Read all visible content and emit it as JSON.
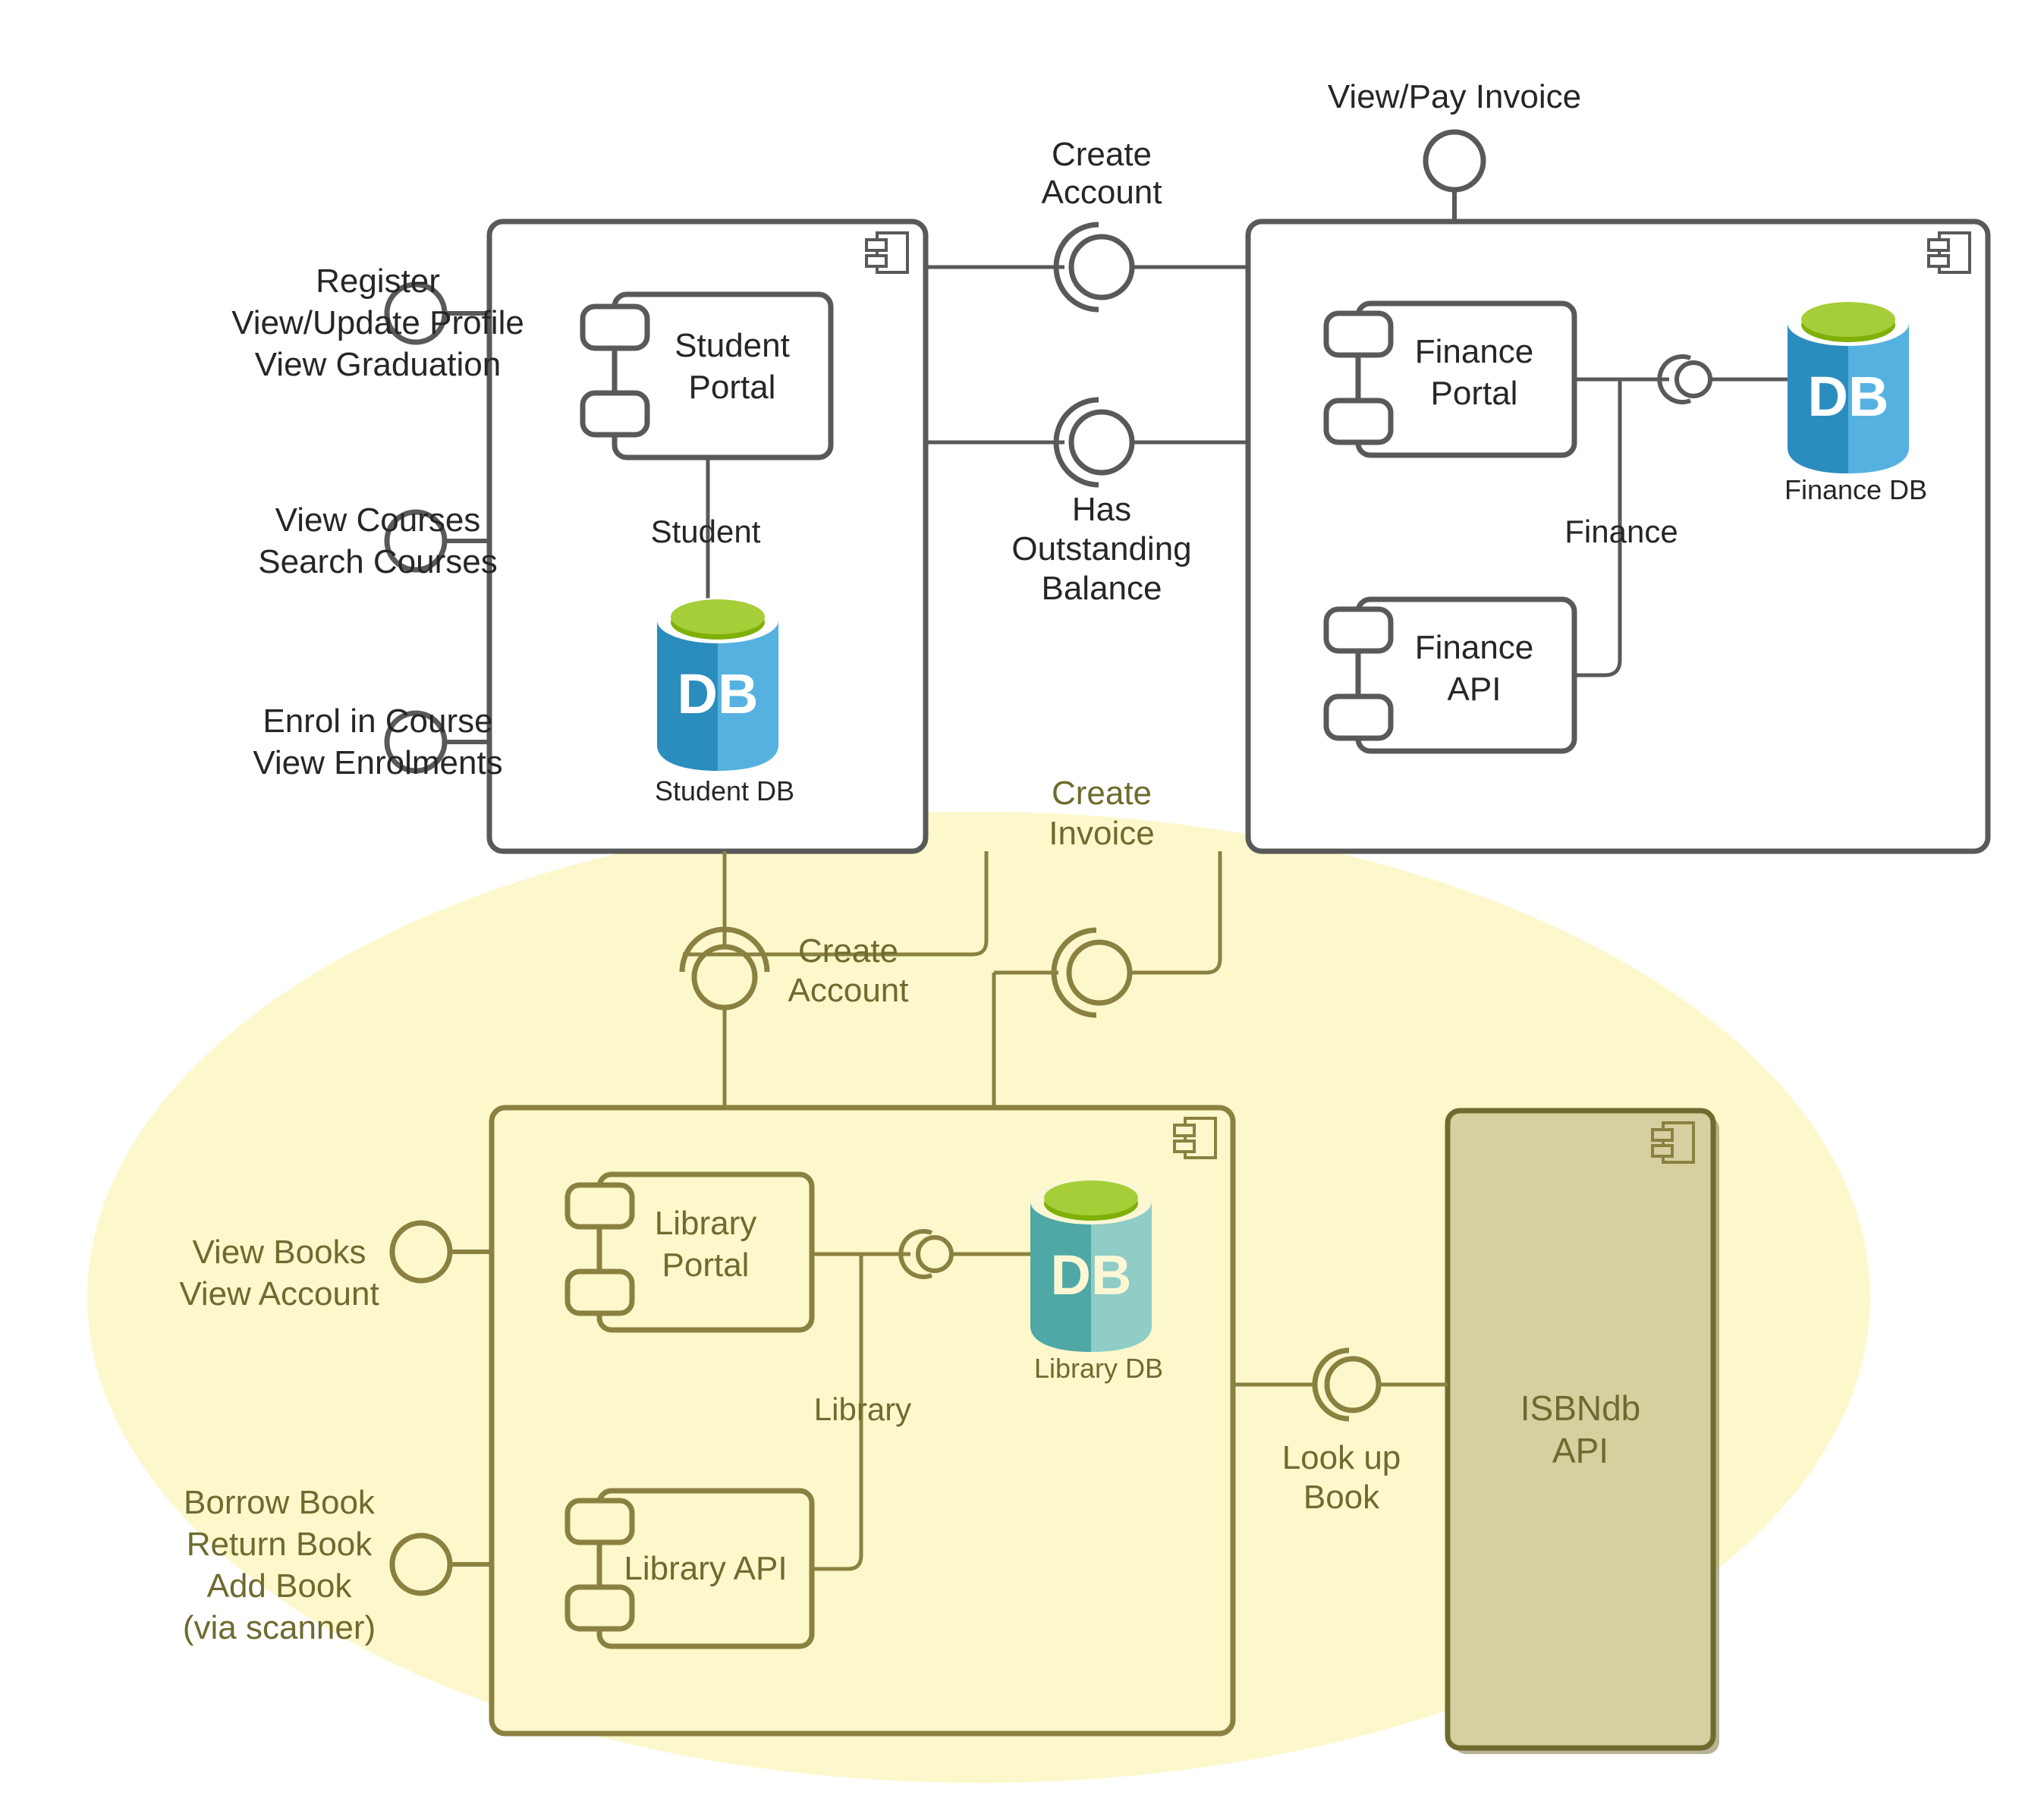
{
  "diagram": {
    "title": "University System Component Diagram",
    "type": "uml-component-diagram",
    "colors": {
      "dark_stroke": "#595959",
      "olive_stroke": "#8a8141",
      "olive_text": "#6f6a2e",
      "pale_yellow_fill": "#fcf8cc",
      "khaki_fill": "#d6d0a0",
      "db_blue_dark": "#2b8cbe",
      "db_blue_light": "#55b2e0",
      "db_green_top": "#a6ce39",
      "db_green_shadow": "#7fb008",
      "db_teal_dark": "#4fa8a5",
      "db_teal_light": "#8fcdc6",
      "white": "#ffffff"
    }
  },
  "packages": {
    "student": {
      "name": "Student",
      "icon": "component-icon"
    },
    "finance": {
      "name": "Finance",
      "icon": "component-icon"
    },
    "library": {
      "name": "Library",
      "icon": "component-icon"
    }
  },
  "components": {
    "student_portal": {
      "label_line1": "Student",
      "label_line2": "Portal"
    },
    "finance_portal": {
      "label_line1": "Finance",
      "label_line2": "Portal"
    },
    "finance_api": {
      "label_line1": "Finance",
      "label_line2": "API"
    },
    "library_portal": {
      "label_line1": "Library",
      "label_line2": "Portal"
    },
    "library_api": {
      "label_line1": "Library API",
      "label_line2": ""
    },
    "isbndb_api": {
      "label_line1": "ISBNdb",
      "label_line2": "API",
      "icon": "component-icon"
    }
  },
  "databases": {
    "student_db": {
      "caption": "Student DB",
      "glyph": "DB",
      "tone": "blue"
    },
    "finance_db": {
      "caption": "Finance DB",
      "glyph": "DB",
      "tone": "blue"
    },
    "library_db": {
      "caption": "Library DB",
      "glyph": "DB",
      "tone": "teal"
    }
  },
  "port_labels": {
    "student_profile": {
      "line1": "Register",
      "line2": "View/Update Profile",
      "line3": "View Graduation"
    },
    "courses": {
      "line1": "View Courses",
      "line2": "Search Courses",
      "line3": ""
    },
    "enrolments": {
      "line1": "Enrol in Course",
      "line2": "View Enrolments",
      "line3": ""
    },
    "library_view": {
      "line1": "View Books",
      "line2": "View Account",
      "line3": ""
    },
    "library_borrow": {
      "line1": "Borrow Book",
      "line2": "Return Book",
      "line3": "Add Book",
      "line4": "(via scanner)"
    },
    "view_pay_invoice": {
      "line1": "View/Pay Invoice"
    }
  },
  "interfaces": {
    "create_account_top": {
      "line1": "Create",
      "line2": "Account"
    },
    "has_outstanding_balance": {
      "line1": "Has",
      "line2": "Outstanding",
      "line3": "Balance"
    },
    "create_invoice": {
      "line1": "Create",
      "line2": "Invoice"
    },
    "create_account_library": {
      "line1": "Create",
      "line2": "Account"
    },
    "look_up_book": {
      "line1": "Look up",
      "line2": "Book"
    }
  },
  "connector_labels": {
    "student": "Student",
    "finance": "Finance",
    "library": "Library"
  }
}
